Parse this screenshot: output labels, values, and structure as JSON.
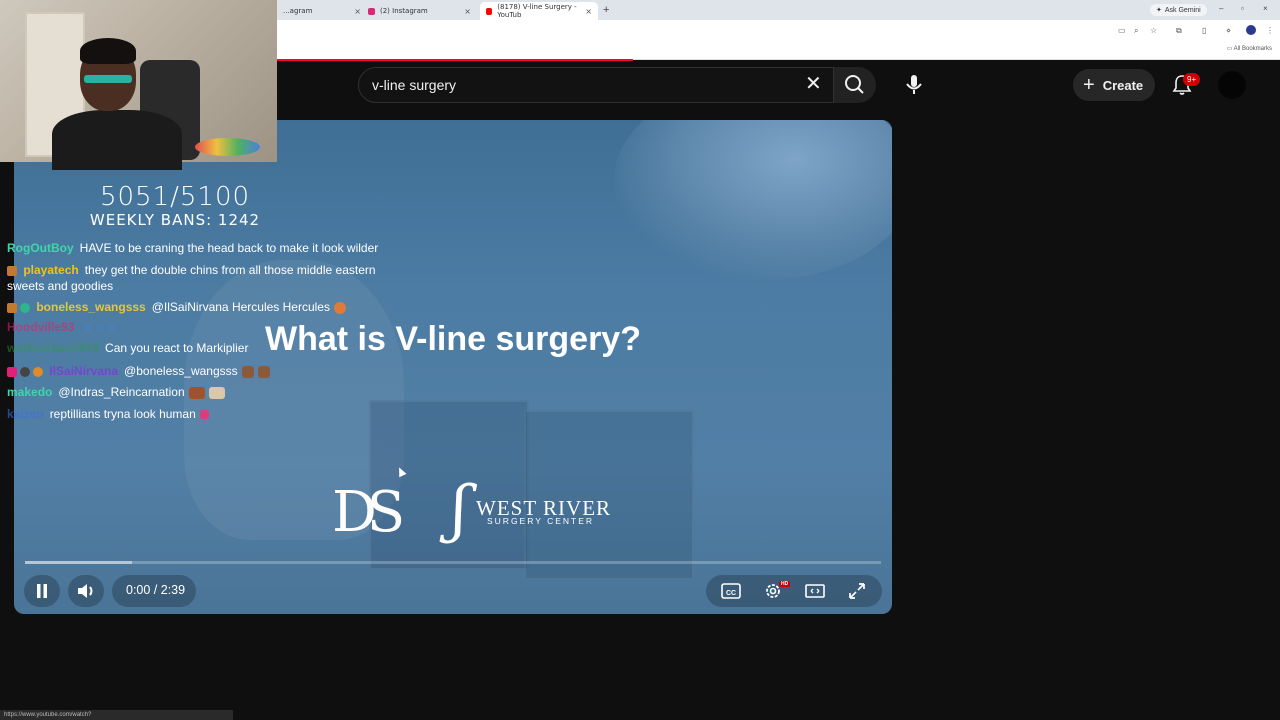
{
  "browser": {
    "tabs": [
      {
        "title": "...agram",
        "icon": "instagram-icon"
      },
      {
        "title": "(2) Instagram",
        "icon": "instagram-icon"
      },
      {
        "title": "(8178) V-line Surgery - YouTub",
        "icon": "youtube-icon"
      }
    ],
    "new_tab_label": "+",
    "ask_gemini_label": "Ask Gemini",
    "all_bookmarks_label": "All Bookmarks"
  },
  "youtube": {
    "search": {
      "value": "v-line surgery"
    },
    "create_label": "Create",
    "notification_count": "9+"
  },
  "player": {
    "video_title": "What is V-line surgery?",
    "logo_left": "DS",
    "logo_right_name": "WEST RIVER",
    "logo_right_sub": "SURGERY CENTER",
    "time": "0:00 / 2:39",
    "played_fraction": 0.0,
    "buffered_fraction": 0.125,
    "hd_badge": "HD",
    "state": "playing"
  },
  "stream_overlay": {
    "counter_main": "5051/5100",
    "counter_sub": "WEEKLY BANS: 1242",
    "chat": [
      {
        "user": "RogOutBoy",
        "color": "#3fd6a8",
        "message": "HAVE to be craning the head back to make it look wilder",
        "badges": 0
      },
      {
        "user": "playatech",
        "color": "#f0c419",
        "message": "they get the double chins from all those middle eastern",
        "badges": 1
      },
      {
        "user": "",
        "color": "#ffffff",
        "message": "sweets and goodies",
        "badges": 0
      },
      {
        "user": "boneless_wangsss",
        "color": "#e8c53a",
        "message": "@IlSaiNirvana Hercules Hercules",
        "badges": 2
      },
      {
        "user": "Hoodville93",
        "color": "#e0206a",
        "message": "",
        "badges": 0
      },
      {
        "user": "wetlovebami918",
        "color": "#2f9b3a",
        "message": "Can you react to Markiplier",
        "badges": 0
      },
      {
        "user": "IlSaiNirvana",
        "color": "#8a2be2",
        "message": "@boneless_wangsss",
        "badges": 3
      },
      {
        "user": "makedo",
        "color": "#3fd6a8",
        "message": "@Indras_Reincarnation",
        "badges": 0
      },
      {
        "user": "kaizen",
        "color": "#3a6fe0",
        "message": "reptillians tryna look human",
        "badges": 0
      }
    ]
  },
  "status_url": "https://www.youtube.com/watch?v=Yky9yacqgpg&pp=ygUOdi1saW5lIHN1cmdlcnk%3D",
  "colors": {
    "accent": "#ff0033",
    "bg": "#0f0f0f",
    "video": "#4c7ca3"
  }
}
